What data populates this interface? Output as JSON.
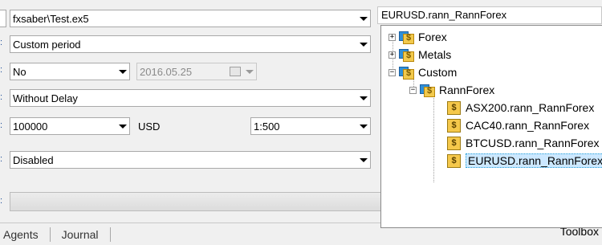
{
  "settings": {
    "expert": "fxsaber\\Test.ex5",
    "period": "Custom period",
    "forward": "No",
    "forward_date": "2016.05.25",
    "delays": "Without Delay",
    "deposit": "100000",
    "currency": "USD",
    "leverage": "1:500",
    "optimization": "Disabled"
  },
  "tabs": [
    "Agents",
    "Journal"
  ],
  "toolbox_label": "Toolbox",
  "symbol_field": "EURUSD.rann_RannForex",
  "tree": {
    "groups": [
      {
        "label": "Forex",
        "expander": "+"
      },
      {
        "label": "Metals",
        "expander": "+"
      },
      {
        "label": "Custom",
        "expander": "−"
      }
    ],
    "subgroup": {
      "label": "RannForex",
      "expander": "−"
    },
    "symbols": [
      "ASX200.rann_RannForex",
      "CAC40.rann_RannForex",
      "BTCUSD.rann_RannForex",
      "EURUSD.rann_RannForex"
    ],
    "selected_symbol": "EURUSD.rann_RannForex"
  }
}
